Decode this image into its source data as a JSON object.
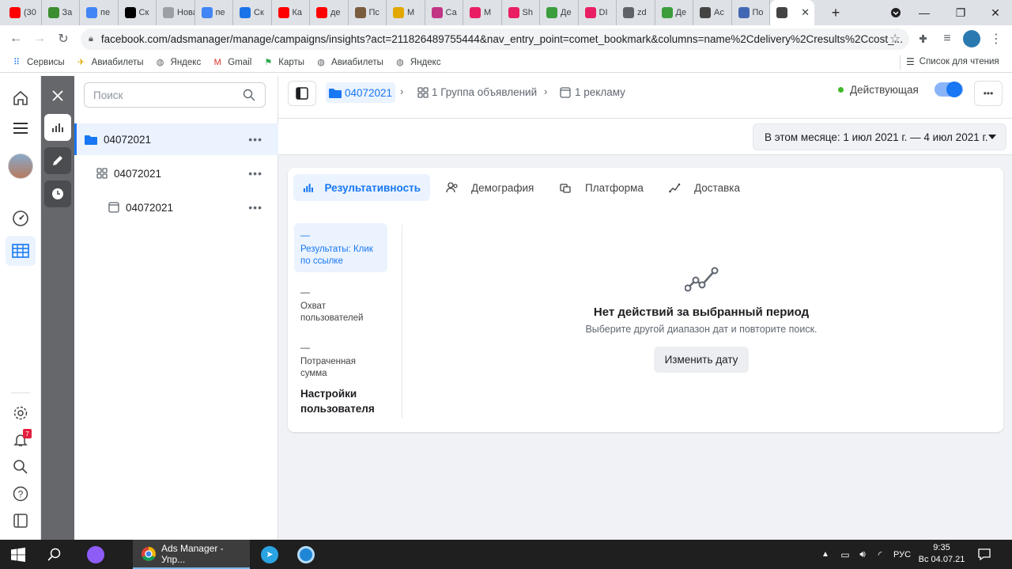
{
  "browser": {
    "tabs": [
      {
        "label": "(30",
        "icon": "youtube-icon",
        "color": "#ff0000"
      },
      {
        "label": "За",
        "icon": "shield-icon",
        "color": "#3c8d2f"
      },
      {
        "label": "пе",
        "icon": "google-icon",
        "color": "#4285f4"
      },
      {
        "label": "Cк",
        "icon": "play-icon",
        "color": "#000000"
      },
      {
        "label": "Новая",
        "icon": "page-icon",
        "color": "#9aa0a6"
      },
      {
        "label": "пе",
        "icon": "google-icon",
        "color": "#4285f4"
      },
      {
        "label": "Ск",
        "icon": "download-icon",
        "color": "#1a73e8"
      },
      {
        "label": "Ка",
        "icon": "youtube-icon",
        "color": "#ff0000"
      },
      {
        "label": "де",
        "icon": "youtube-icon",
        "color": "#ff0000"
      },
      {
        "label": "Пс",
        "icon": "person-icon",
        "color": "#7a5c3e"
      },
      {
        "label": "М",
        "icon": "sun-icon",
        "color": "#e0a800"
      },
      {
        "label": "Са",
        "icon": "instagram-icon",
        "color": "#c13584"
      },
      {
        "label": "М",
        "icon": "chat-icon",
        "color": "#e91e63"
      },
      {
        "label": "Sh",
        "icon": "star-icon",
        "color": "#e91e63"
      },
      {
        "label": "Де",
        "icon": "hd-icon",
        "color": "#3c9d3c"
      },
      {
        "label": "DI",
        "icon": "chat-icon",
        "color": "#e91e63"
      },
      {
        "label": "zd",
        "icon": "globe-icon",
        "color": "#5f6368"
      },
      {
        "label": "Де",
        "icon": "hd-icon",
        "color": "#3c9d3c"
      },
      {
        "label": "Ас",
        "icon": "ads-icon",
        "color": "#444444"
      },
      {
        "label": "По",
        "icon": "fb-icon",
        "color": "#4267b2"
      },
      {
        "label": "",
        "icon": "ads-icon",
        "color": "#444444",
        "active": true
      }
    ],
    "url": "facebook.com/adsmanager/manage/campaigns/insights?act=211826489755444&nav_entry_point=comet_bookmark&columns=name%2Cdelivery%2Cresults%2Ccost_...",
    "bookmarks": [
      {
        "label": "Сервисы",
        "icon": "apps-icon"
      },
      {
        "label": "Авиабилеты",
        "icon": "plane-icon"
      },
      {
        "label": "Яндекс",
        "icon": "globe-icon"
      },
      {
        "label": "Gmail",
        "icon": "gmail-icon"
      },
      {
        "label": "Карты",
        "icon": "maps-icon"
      },
      {
        "label": "Авиабилеты",
        "icon": "globe-icon"
      },
      {
        "label": "Яндекс",
        "icon": "globe-icon"
      }
    ],
    "reading_list": "Список для чтения"
  },
  "tree": {
    "search_placeholder": "Поиск",
    "campaign": "04072021",
    "adset": "04072021",
    "ad": "04072021"
  },
  "topbar": {
    "campaign": "04072021",
    "adset": "1 Группа объявлений",
    "ad": "1 рекламу",
    "status": "Действующая",
    "status_color": "#42b72a"
  },
  "date_range": "В этом месяце: 1 июл 2021 г. — 4 июл 2021 г.",
  "insights": {
    "tabs": [
      "Результативность",
      "Демография",
      "Платформа",
      "Доставка"
    ],
    "metrics": [
      {
        "value": "—",
        "label": "Результаты: Клик по ссылке"
      },
      {
        "value": "—",
        "label": "Охват пользователей"
      },
      {
        "value": "—",
        "label": "Потраченная сумма"
      }
    ],
    "user_settings": "Настройки пользователя",
    "empty_title": "Нет действий за выбранный период",
    "empty_subtitle": "Выберите другой диапазон дат и повторите поиск.",
    "change_date": "Изменить дату"
  },
  "notifications_count": "7",
  "taskbar": {
    "app_label": "Ads Manager - Упр...",
    "lang": "РУС",
    "time": "9:35",
    "date": "Вс 04.07.21"
  },
  "accent_color": "#1877f2"
}
